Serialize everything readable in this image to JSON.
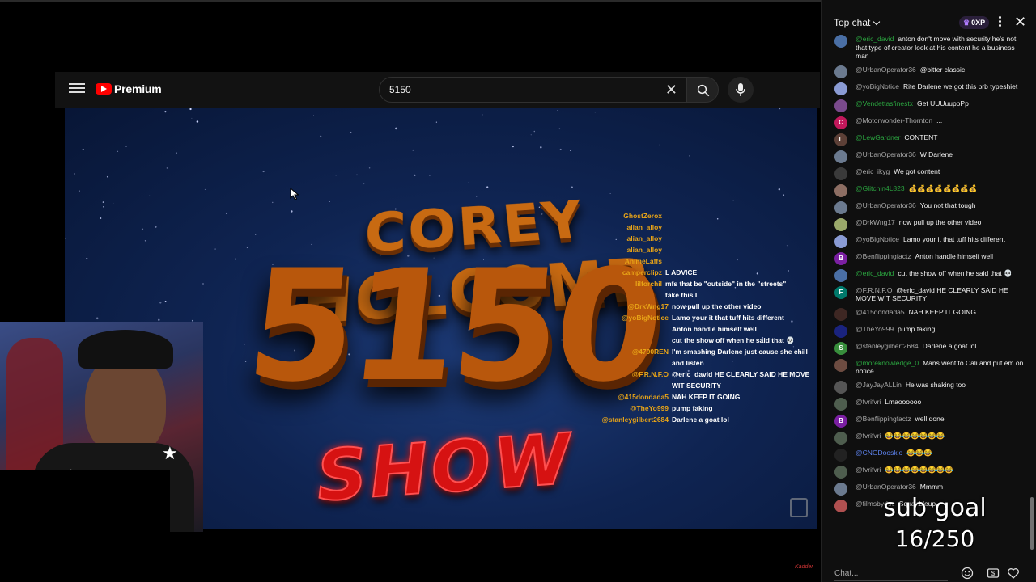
{
  "youtube": {
    "logo_text": "Premium",
    "search_value": "5150",
    "clear_symbol": "✕"
  },
  "video": {
    "title_top": "COREY HOLCOMB",
    "title_number": "5150",
    "title_bottom": "SHOW",
    "overlay_chat": [
      {
        "user": "GhostZerox",
        "msg": ""
      },
      {
        "user": "alian_alloy",
        "msg": ""
      },
      {
        "user": "alian_alloy",
        "msg": ""
      },
      {
        "user": "alian_alloy",
        "msg": ""
      },
      {
        "user": "AnimeLaffs",
        "msg": ""
      },
      {
        "user": "camperclipz",
        "msg": "L ADVICE"
      },
      {
        "user": "lilforchil",
        "msg": "mfs that be \"outside\" in the \"streets\""
      },
      {
        "user": "",
        "msg": "take this L"
      },
      {
        "user": "@DrkWng17",
        "msg": "now pull up the other video"
      },
      {
        "user": "@yoBigNotice",
        "msg": "Lamo your it that tuff hits different"
      },
      {
        "user": "",
        "msg": "Anton handle himself well"
      },
      {
        "user": "",
        "msg": "cut the show off when he said that 💀"
      },
      {
        "user": "@4700REN",
        "msg": "I'm smashing Darlene just cause she chill and listen"
      },
      {
        "user": "@F.R.N.F.O",
        "msg": "@eric_david HE CLEARLY SAID HE MOVE WIT SECURITY"
      },
      {
        "user": "@415dondada5",
        "msg": "NAH KEEP IT GOING"
      },
      {
        "user": "@TheYo999",
        "msg": "pump faking"
      },
      {
        "user": "@stanleygilbert2684",
        "msg": "Darlene a goat lol"
      }
    ]
  },
  "chat": {
    "mode_label": "Top chat",
    "xp_label": "0XP",
    "input_placeholder": "Chat...",
    "messages": [
      {
        "author": "@eric_david",
        "text": "anton don't move with security he's not that type of creator look at his content he a business man",
        "color": "#4a6fa5",
        "author_style": "green",
        "initial": ""
      },
      {
        "author": "@UrbanOperator36",
        "text": "@bitter classic",
        "color": "#6b7a8f",
        "author_style": "",
        "initial": ""
      },
      {
        "author": "@yoBigNotice",
        "text": "Rite Darlene we got this brb typeshiet",
        "color": "#8a9bd4",
        "author_style": "",
        "initial": ""
      },
      {
        "author": "@Vendettasfinestx",
        "text": "Get UUUuuppPp",
        "color": "#7a4a8c",
        "author_style": "green",
        "initial": ""
      },
      {
        "author": "@Motorwonder-Thornton",
        "text": "...",
        "color": "#c2185b",
        "author_style": "",
        "initial": "C"
      },
      {
        "author": "@LewGardner",
        "text": "CONTENT",
        "color": "#5d4037",
        "author_style": "green",
        "initial": "L"
      },
      {
        "author": "@UrbanOperator36",
        "text": "W Darlene",
        "color": "#6b7a8f",
        "author_style": "",
        "initial": ""
      },
      {
        "author": "@eric_ikyg",
        "text": "We got content",
        "color": "#3a3a3a",
        "author_style": "",
        "initial": ""
      },
      {
        "author": "@Glitchin4L823",
        "text": "💰💰💰💰💰💰💰💰",
        "color": "#8d6e63",
        "author_style": "green",
        "initial": ""
      },
      {
        "author": "@UrbanOperator36",
        "text": "You not that tough",
        "color": "#6b7a8f",
        "author_style": "",
        "initial": ""
      },
      {
        "author": "@DrkWng17",
        "text": "now pull up the other video",
        "color": "#9aa86a",
        "author_style": "",
        "initial": ""
      },
      {
        "author": "@yoBigNotice",
        "text": "Lamo your it that tuff hits different",
        "color": "#8a9bd4",
        "author_style": "",
        "initial": ""
      },
      {
        "author": "@Benflippingfactz",
        "text": "Anton handle himself well",
        "color": "#7b1fa2",
        "author_style": "",
        "initial": "B"
      },
      {
        "author": "@eric_david",
        "text": "cut the show off when he said that 💀",
        "color": "#4a6fa5",
        "author_style": "green",
        "initial": ""
      },
      {
        "author": "@F.R.N.F.O",
        "text": "@eric_david HE CLEARLY SAID HE MOVE WIT SECURITY",
        "color": "#00796b",
        "author_style": "",
        "initial": "F"
      },
      {
        "author": "@415dondada5",
        "text": "NAH KEEP IT GOING",
        "color": "#3e2723",
        "author_style": "",
        "initial": ""
      },
      {
        "author": "@TheYo999",
        "text": "pump faking",
        "color": "#1a237e",
        "author_style": "",
        "initial": ""
      },
      {
        "author": "@stanleygilbert2684",
        "text": "Darlene a goat lol",
        "color": "#388e3c",
        "author_style": "",
        "initial": "S"
      },
      {
        "author": "@moreknowledge_0",
        "text": "Mans went to Cali and put em on notice.",
        "color": "#6d4c41",
        "author_style": "green",
        "initial": ""
      },
      {
        "author": "@JayJayALLin",
        "text": "He was shaking too",
        "color": "#555",
        "author_style": "",
        "initial": ""
      },
      {
        "author": "@fvrifvri",
        "text": "Lmaoooooo",
        "color": "#4e5d4e",
        "author_style": "",
        "initial": ""
      },
      {
        "author": "@Benflippingfactz",
        "text": "well done",
        "color": "#7b1fa2",
        "author_style": "",
        "initial": "B"
      },
      {
        "author": "@fvrifvri",
        "text": "😂😂😂😂😂😂😂",
        "color": "#4e5d4e",
        "author_style": "",
        "initial": ""
      },
      {
        "author": "@CNGDooskio",
        "text": "😂😂😂",
        "color": "#222",
        "author_style": "blue",
        "initial": ""
      },
      {
        "author": "@fvrifvri",
        "text": "😂😂😂😂😂😂😂😂",
        "color": "#4e5d4e",
        "author_style": "",
        "initial": ""
      },
      {
        "author": "@UrbanOperator36",
        "text": "Mmmm",
        "color": "#6b7a8f",
        "author_style": "",
        "initial": ""
      },
      {
        "author": "@filmsbydoc",
        "text": "Squabbleup",
        "color": "#b05050",
        "author_style": "",
        "initial": ""
      }
    ]
  },
  "sub_goal": {
    "label": "sub goal",
    "count": "16/250"
  },
  "corner_logo": "Kadder"
}
